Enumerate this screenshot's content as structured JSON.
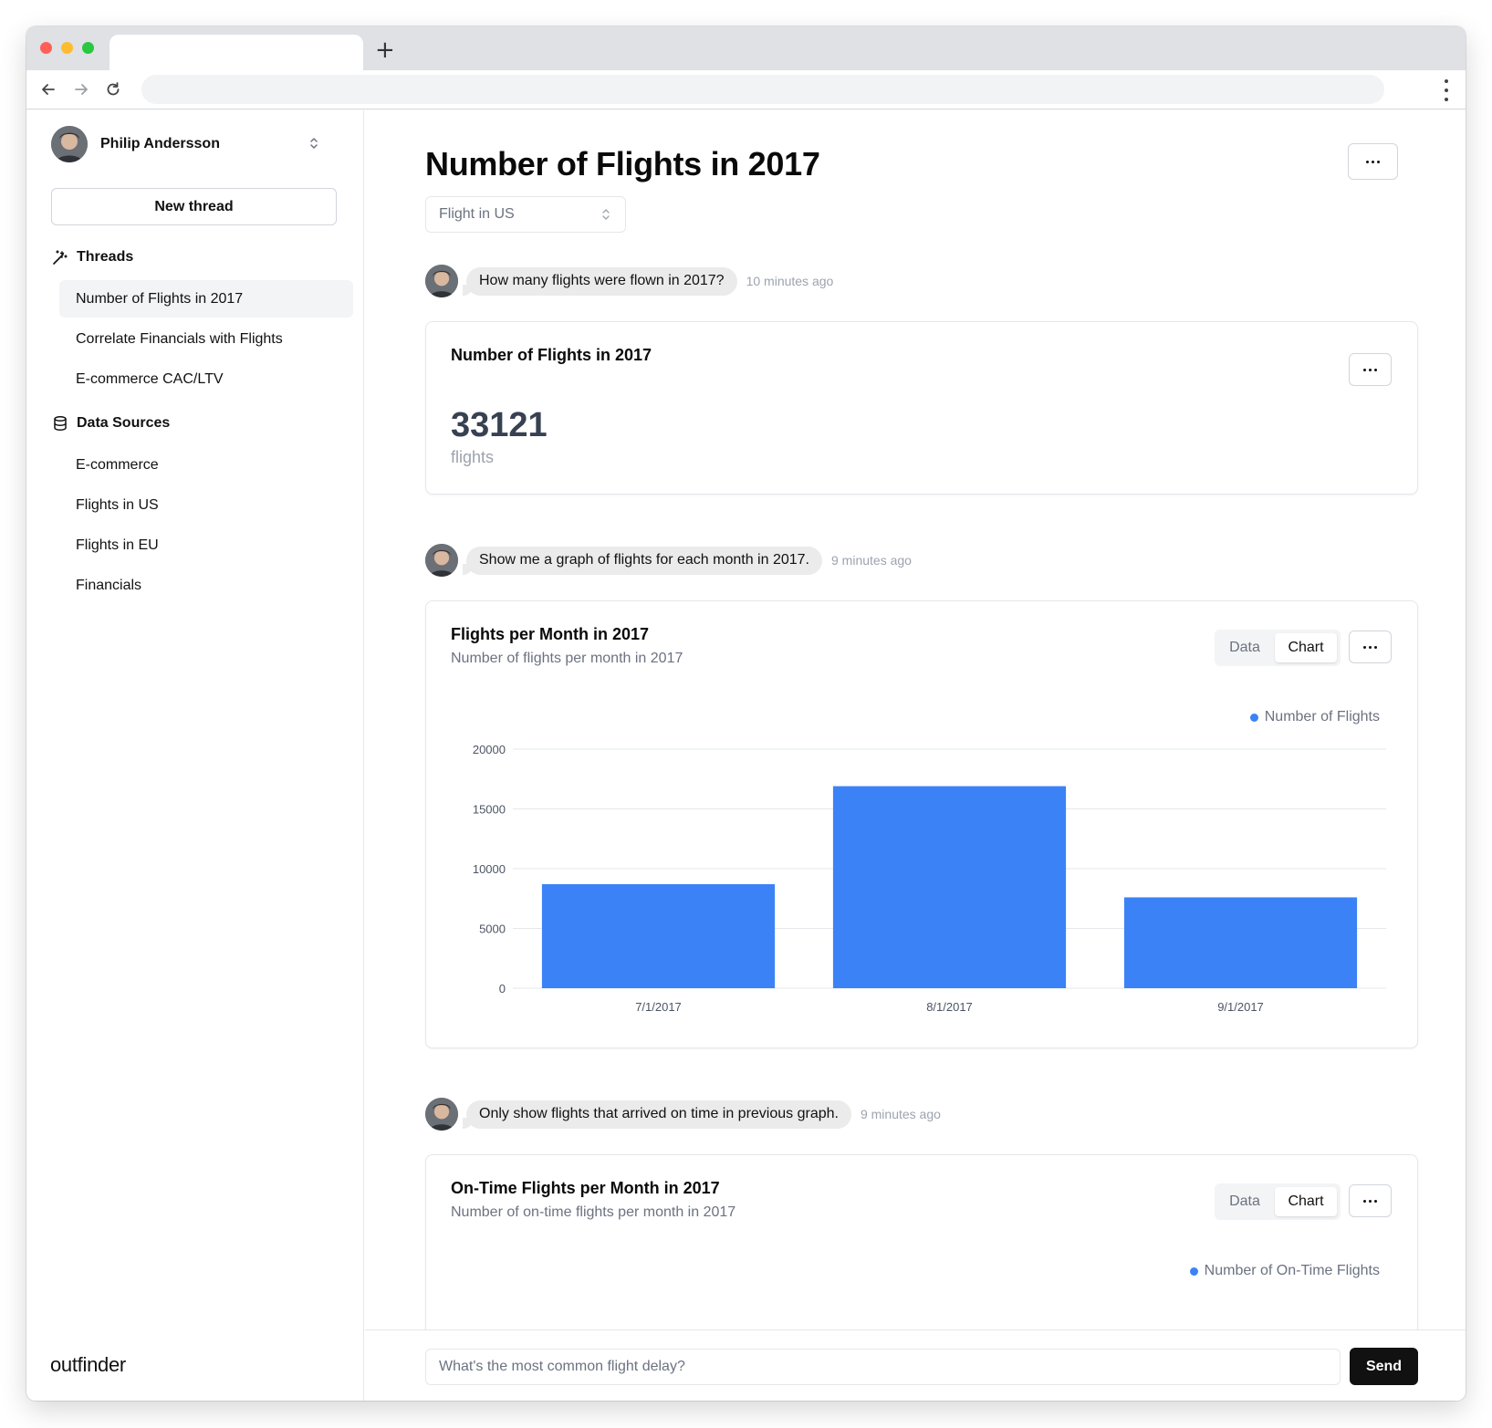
{
  "browser": {
    "new_tab_glyph": "+",
    "icons": [
      "back-arrow-icon",
      "forward-arrow-icon",
      "reload-icon",
      "kebab-menu-icon"
    ]
  },
  "sidebar": {
    "user_name": "Philip Andersson",
    "new_thread_label": "New thread",
    "threads_label": "Threads",
    "threads": [
      {
        "label": "Number of Flights in 2017",
        "active": true
      },
      {
        "label": "Correlate Financials with Flights",
        "active": false
      },
      {
        "label": "E-commerce CAC/LTV",
        "active": false
      }
    ],
    "data_sources_label": "Data Sources",
    "data_sources": [
      {
        "label": "E-commerce"
      },
      {
        "label": "Flights in US"
      },
      {
        "label": "Flights in EU"
      },
      {
        "label": "Financials"
      }
    ],
    "logo_text": "outfinder"
  },
  "main": {
    "title": "Number of Flights in 2017",
    "data_source_select": "Flight in US",
    "messages": [
      {
        "text": "How many flights were flown in 2017?",
        "time": "10 minutes ago"
      },
      {
        "text": "Show me a graph of flights for each month in 2017.",
        "time": "9 minutes ago"
      },
      {
        "text": "Only show flights that arrived on time in previous graph.",
        "time": "9 minutes ago"
      }
    ],
    "results": [
      {
        "title": "Number of Flights in 2017",
        "value": "33121",
        "unit": "flights"
      },
      {
        "title": "Flights per Month in 2017",
        "subtitle": "Number of flights per month in 2017",
        "tab_data": "Data",
        "tab_chart": "Chart",
        "legend": "Number of Flights"
      },
      {
        "title": "On-Time Flights per Month in 2017",
        "subtitle": "Number of on-time flights per month in 2017",
        "tab_data": "Data",
        "tab_chart": "Chart",
        "legend": "Number of On-Time Flights"
      }
    ],
    "input_placeholder": "What's the most common flight delay?",
    "send_label": "Send"
  },
  "colors": {
    "accent_bar": "#3b82f6",
    "send_button": "#111111",
    "active_thread_bg": "#f3f4f6"
  },
  "chart_data": {
    "type": "bar",
    "title": "Flights per Month in 2017",
    "subtitle": "Number of flights per month in 2017",
    "categories": [
      "7/1/2017",
      "8/1/2017",
      "9/1/2017"
    ],
    "series": [
      {
        "name": "Number of Flights",
        "values": [
          8700,
          16900,
          7600
        ]
      }
    ],
    "y_ticks": [
      "0",
      "5000",
      "10000",
      "15000",
      "20000"
    ],
    "ylim": [
      0,
      20000
    ],
    "grid": true,
    "legend_position": "top-right"
  }
}
